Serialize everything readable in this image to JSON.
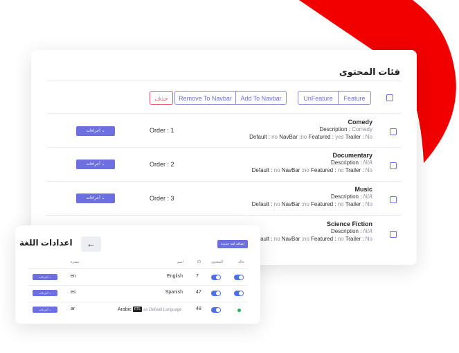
{
  "colors": {
    "accent": "#6b6fe0",
    "danger": "#e45a6d",
    "blob": "#f20000",
    "toggle": "#4f6fe6",
    "status_ok": "#22b35e"
  },
  "main": {
    "title": "فئات المحتوى",
    "toolbar": {
      "delete_label": "حذف",
      "remove_navbar_label": "Remove To Navbar",
      "add_navbar_label": "Add To Navbar",
      "unfeature_label": "UnFeature",
      "feature_label": "Feature"
    },
    "rows": [
      {
        "title": "Comedy",
        "desc_label": "Description :",
        "desc_value": "Comedy",
        "meta_pre": "Default : ",
        "meta_default": "no",
        "meta_mid": " NavBar :",
        "meta_navbar": "no",
        "meta_feat_label": " Featured : ",
        "meta_featured": "yes",
        "meta_trailer_label": " Trailer : ",
        "meta_trailer": "No",
        "order": "Order : 1",
        "actions": "أجراءات"
      },
      {
        "title": "Documentary",
        "desc_label": "Description :",
        "desc_value": "N/A",
        "meta_pre": "Default : ",
        "meta_default": "no",
        "meta_mid": " NavBar :",
        "meta_navbar": "no",
        "meta_feat_label": " Featured : ",
        "meta_featured": "no",
        "meta_trailer_label": " Trailer : ",
        "meta_trailer": "No",
        "order": "Order : 2",
        "actions": "أجراءات"
      },
      {
        "title": "Music",
        "desc_label": "Description :",
        "desc_value": "N/A",
        "meta_pre": "Default : ",
        "meta_default": "no",
        "meta_mid": " NavBar :",
        "meta_navbar": "no",
        "meta_feat_label": " Featured : ",
        "meta_featured": "no",
        "meta_trailer_label": " Trailer : ",
        "meta_trailer": "No",
        "order": "Order : 3",
        "actions": "أجراءات"
      },
      {
        "title": "Science Fiction",
        "desc_label": "Description :",
        "desc_value": "N/A",
        "meta_pre": "Default : ",
        "meta_default": "no",
        "meta_mid": " NavBar :",
        "meta_navbar": "no",
        "meta_feat_label": " Featured : ",
        "meta_featured": "no",
        "meta_trailer_label": " Trailer : ",
        "meta_trailer": "No"
      }
    ]
  },
  "languages": {
    "title": "اعدادات اللغة",
    "back_icon": "arrow-left-icon",
    "back_glyph": "←",
    "add_label": "إضافة لغة جديدة",
    "headers": {
      "status": "حالة",
      "content": "المحتوى",
      "id": "ID",
      "name": "اسم",
      "code": "شفرة"
    },
    "rows": [
      {
        "actions": "أجراءات",
        "code": "en",
        "name": "English",
        "id": "7",
        "content_on": true,
        "status": "toggle"
      },
      {
        "actions": "أجراءات",
        "code": "es",
        "name": "Spanish",
        "id": "47",
        "content_on": true,
        "status": "toggle"
      },
      {
        "actions": "أجراءات",
        "code": "ar",
        "name": "Arabic",
        "rtl": "RTL",
        "default_note": "as Default Language",
        "id": "48",
        "content_on": true,
        "status": "dot"
      }
    ]
  }
}
